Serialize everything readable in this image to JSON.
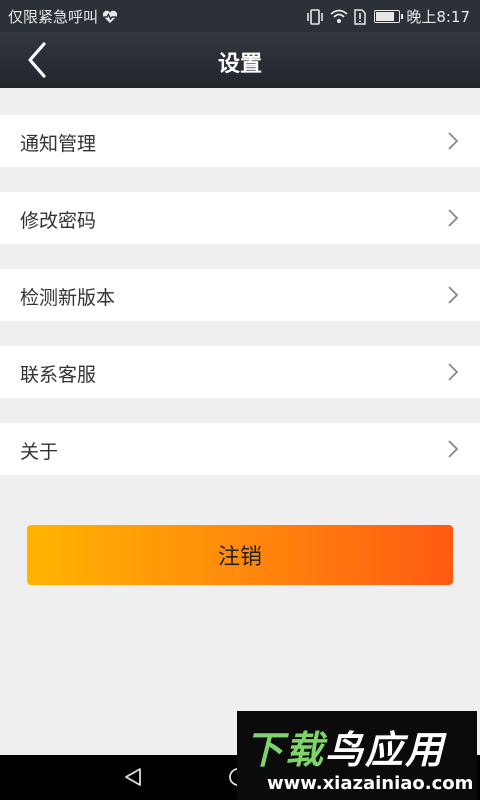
{
  "status_bar": {
    "left_text": "仅限紧急呼叫",
    "time": "晚上8:17",
    "battery_level": 0.75
  },
  "header": {
    "title": "设置",
    "back_icon": "chevron-left-icon"
  },
  "menu": {
    "items": [
      {
        "label": "通知管理"
      },
      {
        "label": "修改密码"
      },
      {
        "label": "检测新版本"
      },
      {
        "label": "联系客服"
      },
      {
        "label": "关于"
      }
    ]
  },
  "logout": {
    "label": "注销"
  },
  "watermark": {
    "title": "下载鸟应用",
    "url": "www.xiazainiao.com"
  },
  "colors": {
    "header_bg": "#2c3138",
    "button_gradient_start": "#ffb400",
    "button_gradient_end": "#ff5a12",
    "page_bg": "#efefef"
  }
}
